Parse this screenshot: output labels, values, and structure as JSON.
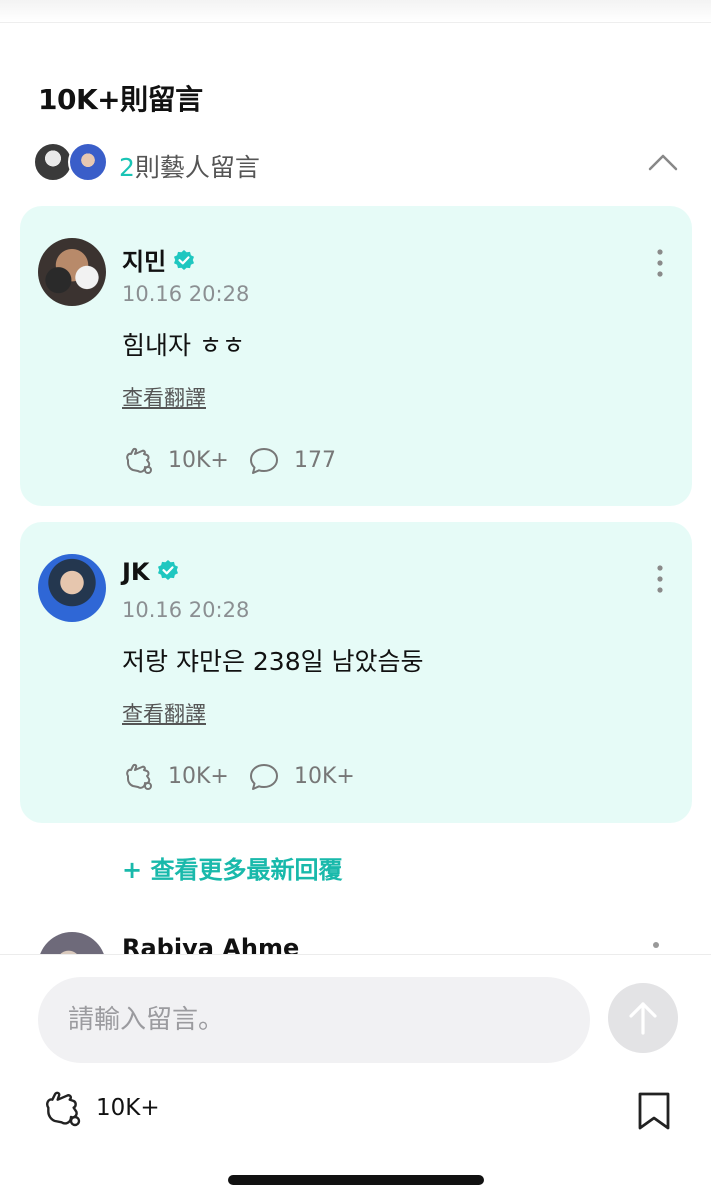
{
  "header": {
    "comment_count": "10K+則留言"
  },
  "artist_section": {
    "count_num": "2",
    "count_label": "則藝人留言"
  },
  "comments": [
    {
      "name": "지민",
      "verified": true,
      "time": "10.16 20:28",
      "text": "힘내자 ㅎㅎ",
      "translate_label": "查看翻譯",
      "likes": "10K+",
      "replies": "177"
    },
    {
      "name": "JK",
      "verified": true,
      "time": "10.16 20:28",
      "text": "저랑 쟈만은 238일 남았슴둥",
      "translate_label": "查看翻譯",
      "likes": "10K+",
      "replies": "10K+"
    }
  ],
  "more_replies_label": "+ 查看更多最新回覆",
  "next_comment": {
    "name": "Rabiya Ahme"
  },
  "composer": {
    "placeholder": "請輸入留言。",
    "post_likes": "10K+"
  },
  "colors": {
    "accent": "#19c4b5",
    "card_bg": "#e6fbf7"
  }
}
